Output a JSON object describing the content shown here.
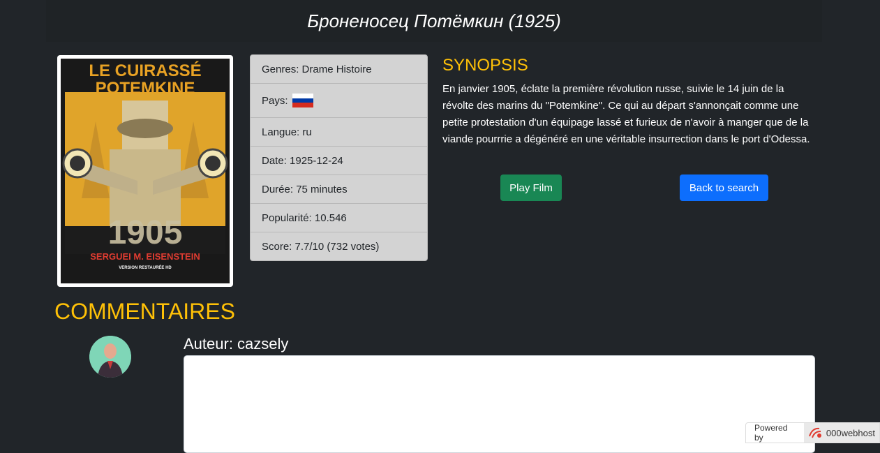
{
  "header": {
    "title": "Броненосец Потёмкин (1925)"
  },
  "poster": {
    "title_line1": "LE CUIRASSÉ",
    "title_line2": "POTEMKINE",
    "year": "1905",
    "director": "SERGUEI M. EISENSTEIN",
    "version": "VERSION RESTAURÉE HD"
  },
  "info": {
    "genres": "Genres: Drame Histoire",
    "country_label": "Pays:",
    "country_flag": "russia-flag-icon",
    "language": "Langue: ru",
    "date": "Date: 1925-12-24",
    "duration": "Durée: 75 minutes",
    "popularity": "Popularité: 10.546",
    "score": "Score: 7.7/10 (732 votes)"
  },
  "synopsis": {
    "title": "SYNOPSIS",
    "text": "En janvier 1905, éclate la première révolution russe, suivie le 14 juin de la révolte des marins du \"Potemkine\". Ce qui au départ s'annonçait comme une petite protestation d'un équipage lassé et furieux de n'avoir à manger que de la viande pourrrie a dégénéré en une véritable insurrection dans le port d'Odessa."
  },
  "actions": {
    "play_label": "Play Film",
    "back_label": "Back to search"
  },
  "comments": {
    "title": "COMMENTAIRES",
    "author": "Auteur: cazsely",
    "avatar": "user-avatar-icon"
  },
  "footer": {
    "powered_by": "Powered by",
    "host": "000webhost"
  },
  "colors": {
    "background": "#212529",
    "accent": "#ffc107",
    "play": "#198754",
    "back": "#0d6efd"
  }
}
